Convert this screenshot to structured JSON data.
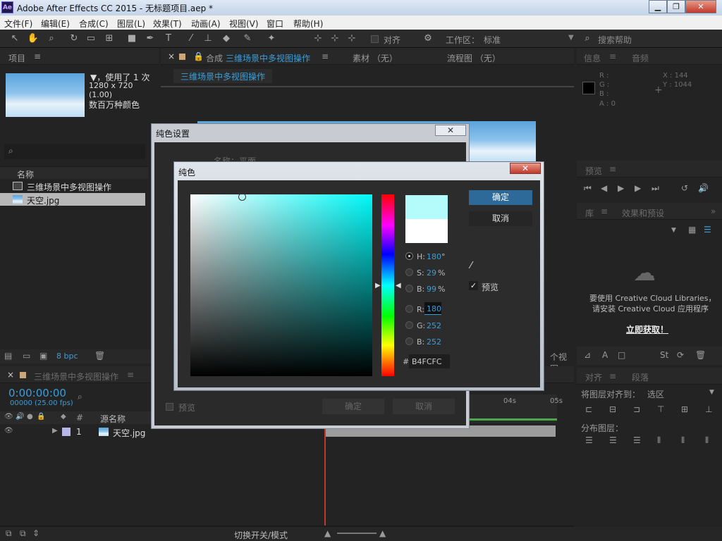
{
  "window": {
    "title": "Adobe After Effects CC 2015 - 无标题项目.aep *",
    "logo": "Ae"
  },
  "menu": [
    "文件(F)",
    "编辑(E)",
    "合成(C)",
    "图层(L)",
    "效果(T)",
    "动画(A)",
    "视图(V)",
    "窗口",
    "帮助(H)"
  ],
  "toolbar": {
    "snap_label": "对齐",
    "workspace_label": "工作区：",
    "workspace_value": "标准",
    "search_placeholder": "搜索帮助"
  },
  "project": {
    "tab": "项目",
    "used": "▼，使用了 1 次",
    "size": "1280 x 720 (1.00)",
    "colors": "数百万种颜色",
    "col_name": "名称",
    "items": [
      {
        "name": "三维场景中多视图操作"
      },
      {
        "name": "天空.jpg"
      }
    ],
    "bpc": "8 bpc"
  },
  "comp": {
    "tab_prefix": "合成",
    "tab_name": "三维场景中多视图操作",
    "material_tab": "素材 （无）",
    "flow_tab": "流程图 （无）",
    "sub_tab": "三维场景中多视图操作",
    "multi_view": "个视图"
  },
  "info": {
    "tab": "信息",
    "audio_tab": "音频",
    "r": "R :",
    "g": "G :",
    "b": "B :",
    "a": "A : 0",
    "x": "X : 144",
    "y": "Y : 1044"
  },
  "preview": {
    "tab": "预览"
  },
  "library": {
    "tab": "库",
    "effects_tab": "效果和预设",
    "msg1": "要使用 Creative Cloud Libraries，",
    "msg2": "请安装 Creative Cloud 应用程序",
    "link": "立即获取！"
  },
  "align": {
    "tab": "对齐",
    "para_tab": "段落",
    "align_to": "将图层对齐到：",
    "align_value": "选区",
    "distribute": "分布图层："
  },
  "timeline": {
    "tab": "三维场景中多视图操作",
    "timecode": "0:00:00:00",
    "frames": "00000 (25.00 fps)",
    "col_source": "源名称",
    "col_hash": "#",
    "layer_num": "1",
    "layer_name": "天空.jpg",
    "ticks": [
      "04s",
      "05s"
    ],
    "toggle": "切换开关/模式"
  },
  "solid_settings": {
    "title": "纯色设置",
    "name_label": "名称：",
    "name_value": "平面",
    "preview": "预览",
    "ok": "确定",
    "cancel": "取消"
  },
  "color_dialog": {
    "title": "纯色",
    "ok": "确定",
    "cancel": "取消",
    "preview": "预览",
    "h_label": "H:",
    "h_value": "180",
    "h_unit": "°",
    "s_label": "S:",
    "s_value": "29",
    "s_unit": "%",
    "b_label": "B:",
    "b_value": "99",
    "b_unit": "%",
    "r_label": "R:",
    "r_value": "180",
    "g_label": "G:",
    "g_value": "252",
    "bl_label": "B:",
    "bl_value": "252",
    "hex_label": "#",
    "hex_value": "B4FCFC",
    "new_color": "#b4fcfc",
    "old_color": "#ffffff"
  }
}
